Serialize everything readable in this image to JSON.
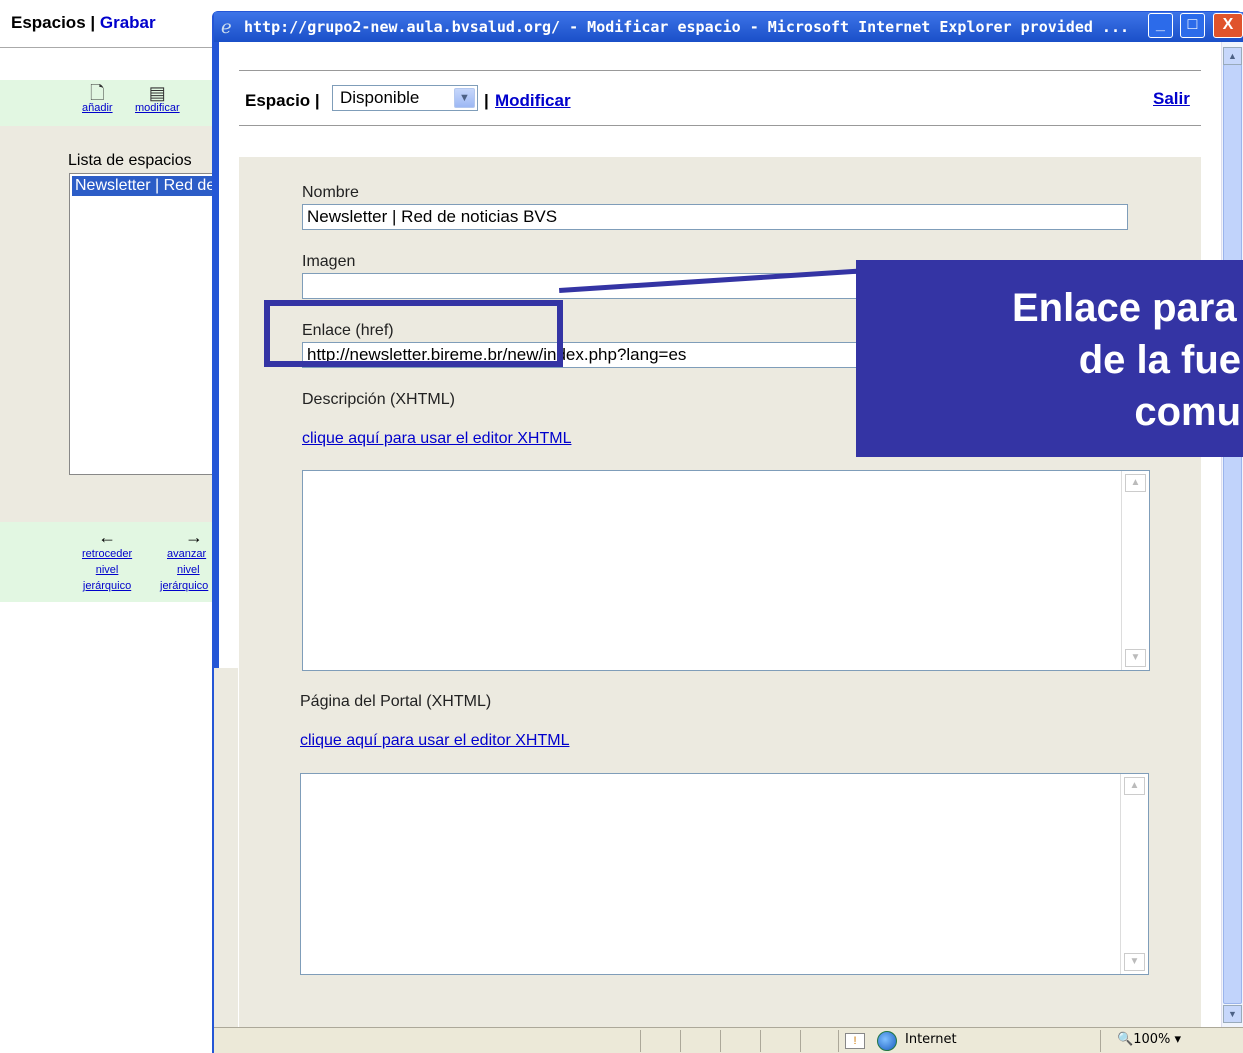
{
  "background": {
    "header": {
      "title": "Espacios",
      "separator": " | ",
      "grabar_link": "Grabar"
    },
    "toolbar": {
      "add_label": "añadir",
      "modify_label": "modificar"
    },
    "list": {
      "label": "Lista de espacios",
      "items": [
        "Newsletter | Red de noticias BVS"
      ]
    },
    "nav": {
      "back": {
        "line1": "retroceder",
        "line2": "nivel",
        "line3": "jerárquico"
      },
      "forward": {
        "line1": "avanzar",
        "line2": "nivel",
        "line3": "jerárquico"
      }
    }
  },
  "window": {
    "title": "http://grupo2-new.aula.bvsalud.org/ - Modificar espacio - Microsoft Internet Explorer provided ...",
    "controls": {
      "minimize": "_",
      "maximize": "□",
      "close": "X"
    }
  },
  "header": {
    "espacio_label": "Espacio |",
    "status_selected": "Disponible",
    "separator": "|",
    "modificar_link": "Modificar",
    "salir_link": "Salir"
  },
  "form": {
    "nombre": {
      "label": "Nombre",
      "value": "Newsletter | Red de noticias BVS"
    },
    "imagen": {
      "label": "Imagen",
      "value": ""
    },
    "enlace": {
      "label": "Enlace (href)",
      "value": "http://newsletter.bireme.br/new/index.php?lang=es"
    },
    "descripcion": {
      "label": "Descripción (XHTML)",
      "editor_link": "clique aquí para usar el editor XHTML"
    },
    "pagina": {
      "label": "Página del Portal (XHTML)",
      "editor_link": "clique aquí para usar el editor XHTML"
    }
  },
  "status_bar": {
    "zone": "Internet",
    "zoom": "100%"
  },
  "callout": {
    "text": "Enlace para la dirección\nde la fuente de la\ncomunidad"
  },
  "colors": {
    "callout": "#3434a4",
    "titlebar": "#1a4fc8",
    "form_bg": "#eceae0",
    "toolbar_bg": "#e2f7e2"
  }
}
